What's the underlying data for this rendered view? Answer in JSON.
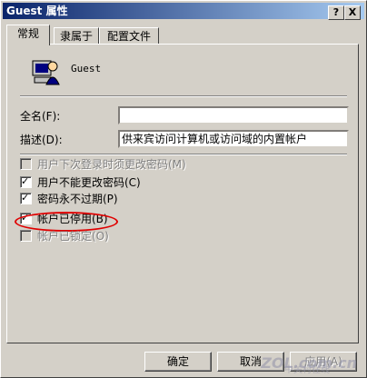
{
  "window": {
    "title": "Guest 属性"
  },
  "titlebar_buttons": {
    "help": "?",
    "close": "X"
  },
  "tabs": [
    {
      "label": "常规"
    },
    {
      "label": "隶属于"
    },
    {
      "label": "配置文件"
    }
  ],
  "user": {
    "name": "Guest"
  },
  "fields": {
    "fullname": {
      "label": "全名(F):",
      "value": ""
    },
    "description": {
      "label": "描述(D):",
      "value": "供来宾访问计算机或访问域的内置帐户"
    }
  },
  "checkboxes": [
    {
      "label": "用户下次登录时须更改密码(M)",
      "checked": false,
      "disabled": true
    },
    {
      "label": "用户不能更改密码(C)",
      "checked": true,
      "disabled": false
    },
    {
      "label": "密码永不过期(P)",
      "checked": true,
      "disabled": false
    },
    {
      "label": "帐户已停用(B)",
      "checked": true,
      "disabled": false
    },
    {
      "label": "帐户已锁定(O)",
      "checked": false,
      "disabled": true
    }
  ],
  "buttons": {
    "ok": "确定",
    "cancel": "取消",
    "apply": "应用(A)"
  },
  "watermark": {
    "brand": "ZOL.com.cn",
    "sub": "中关村在线"
  }
}
